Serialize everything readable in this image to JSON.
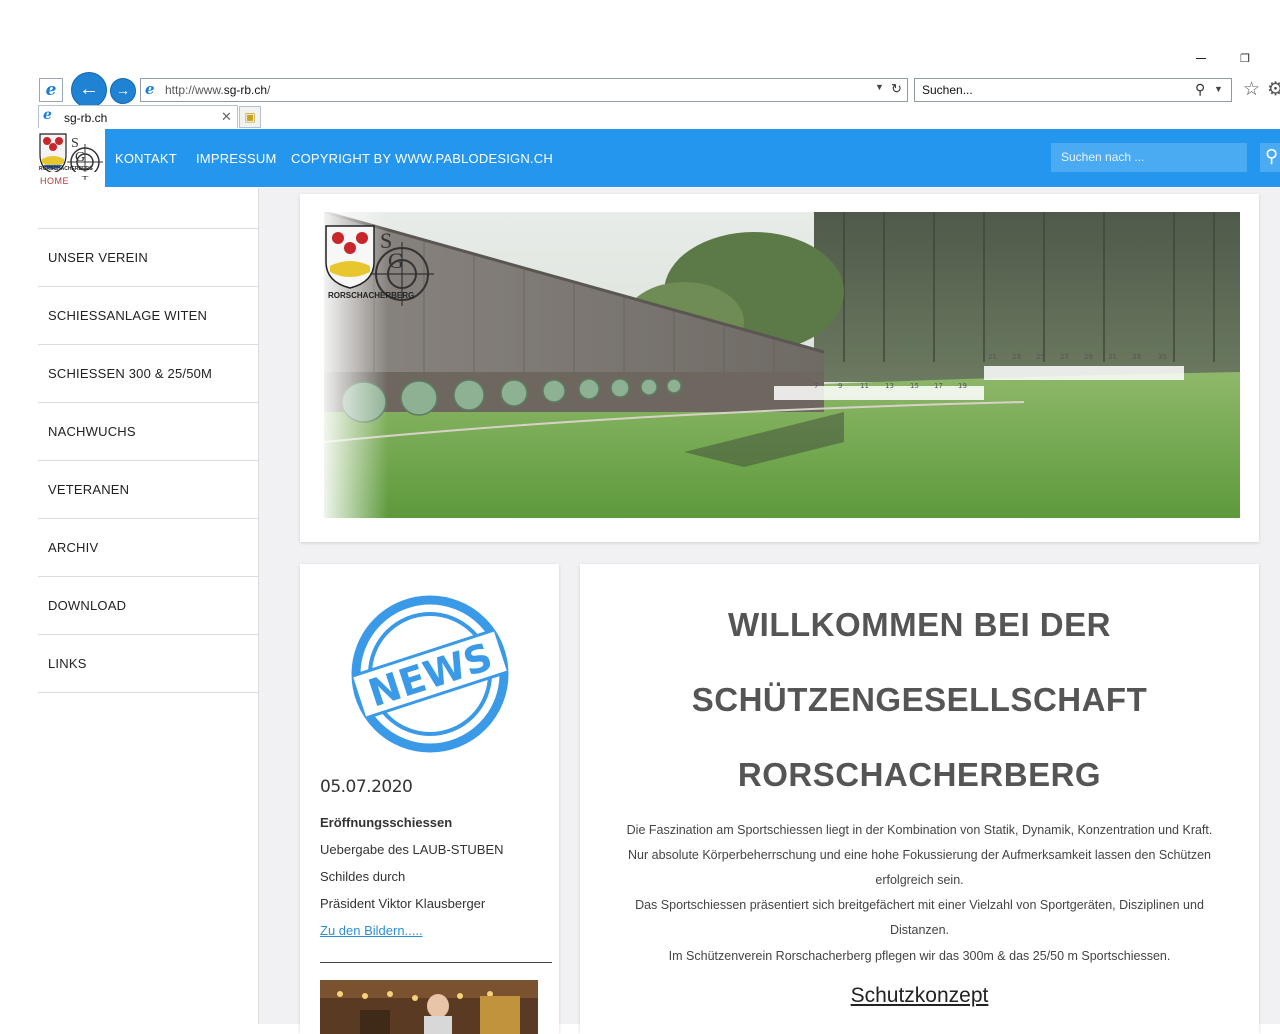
{
  "browser": {
    "url_prefix": "http://www.",
    "url_domain": "sg-rb.ch",
    "url_suffix": "/",
    "search_placeholder": "Suchen...",
    "tab_title": "sg-rb.ch"
  },
  "header": {
    "logo_caption": "HOME",
    "nav": [
      "KONTAKT",
      "IMPRESSUM",
      "COPYRIGHT BY WWW.PABLODESIGN.CH"
    ],
    "search_placeholder": "Suchen nach ..."
  },
  "sidebar": {
    "items": [
      "UNSER VEREIN",
      "SCHIESSANLAGE WITEN",
      "SCHIESSEN 300 & 25/50M",
      "NACHWUCHS",
      "VETERANEN",
      "ARCHIV",
      "DOWNLOAD",
      "LINKS"
    ]
  },
  "banner": {
    "logo_text": "RORSCHACHERBERG",
    "target_numbers": [
      "7",
      "9",
      "11",
      "13",
      "15",
      "17",
      "19",
      "21",
      "23",
      "25",
      "27",
      "29",
      "31",
      "33",
      "35"
    ]
  },
  "news": {
    "stamp_text": "NEWS",
    "date": "05.07.2020",
    "title": "Eröffnungsschiessen",
    "lines": [
      "Uebergabe des LAUB-STUBEN",
      "Schildes durch",
      "Präsident Viktor Klausberger"
    ],
    "link": "Zu den Bildern....."
  },
  "welcome": {
    "heading_lines": [
      "WILLKOMMEN BEI DER",
      "SCHÜTZENGESELLSCHAFT",
      "RORSCHACHERBERG"
    ],
    "intro_lines": [
      "Die Faszination am Sportschiessen liegt in der Kombination von Statik, Dynamik, Konzentration und Kraft.",
      "Nur absolute Körperbeherrschung und eine hohe Fokussierung der Aufmerksamkeit lassen den Schützen",
      "erfolgreich sein.",
      "Das Sportschiessen präsentiert sich breitgefächert mit einer Vielzahl von Sportgeräten, Disziplinen und",
      "Distanzen.",
      "Im Schützenverein Rorschacherberg pflegen wir das 300m & das 25/50 m Sportschiessen."
    ],
    "link": "Schutzkonzept"
  },
  "colors": {
    "header_blue": "#2596ee",
    "link_blue": "#2d8fd8",
    "stamp_blue": "#3a9ae8"
  }
}
